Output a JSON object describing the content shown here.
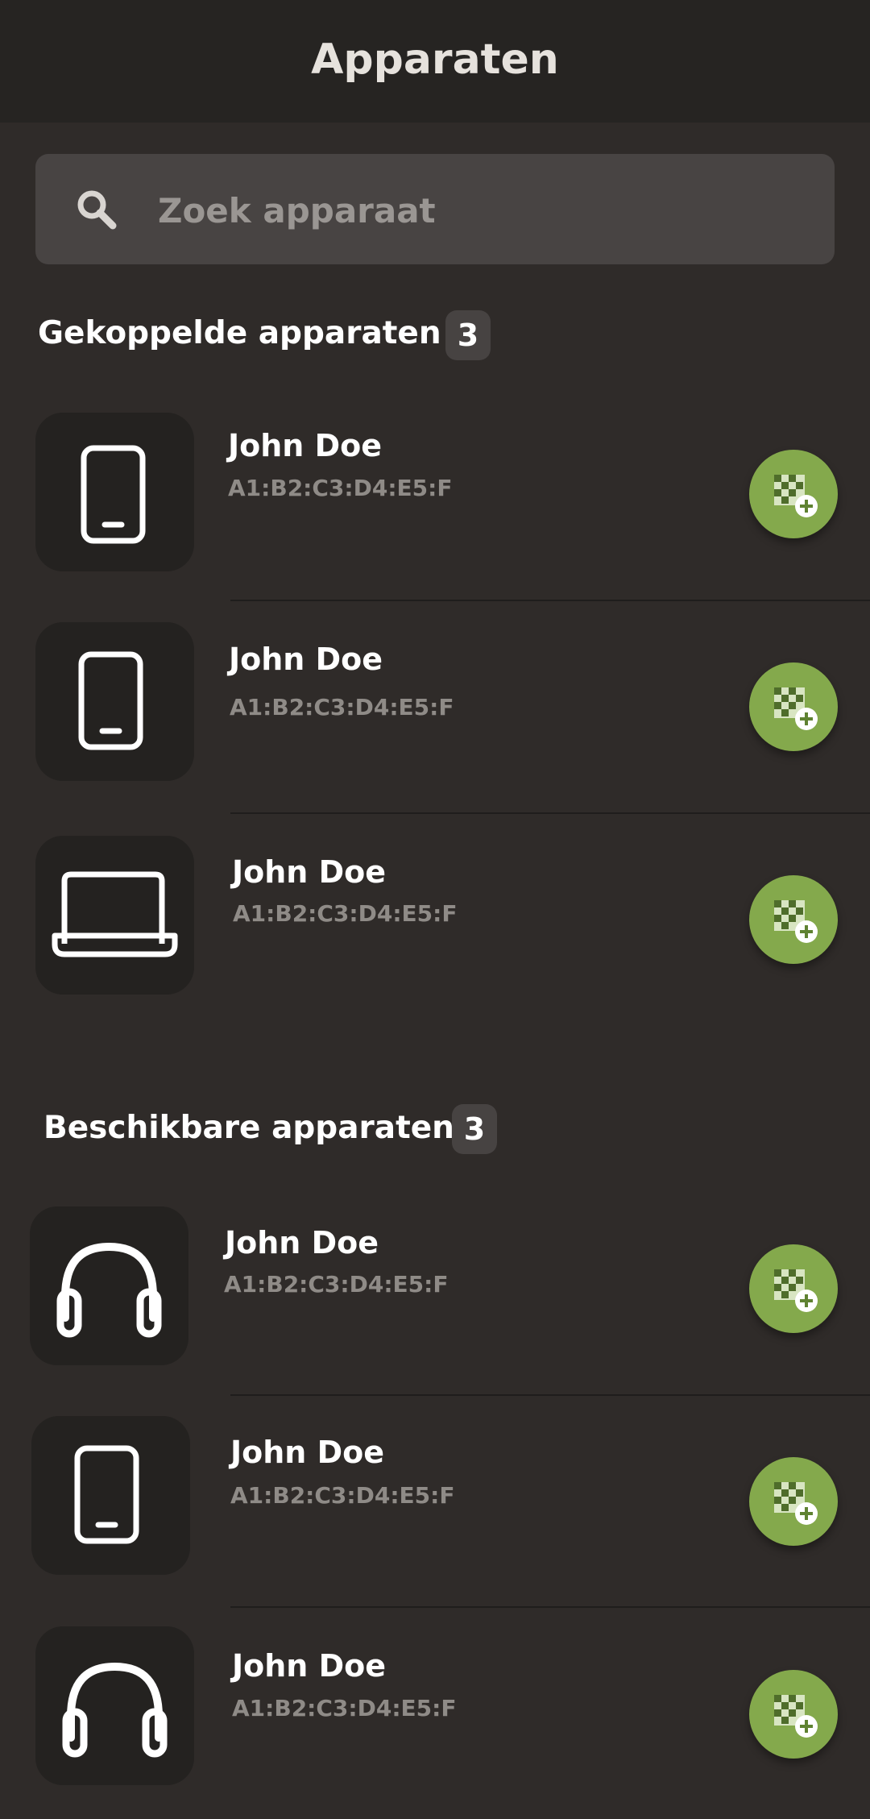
{
  "header": {
    "title": "Apparaten"
  },
  "search": {
    "placeholder": "Zoek apparaat",
    "value": ""
  },
  "sections": [
    {
      "title": "Gekoppelde apparaten",
      "count": "3",
      "devices": [
        {
          "name": "John Doe",
          "mac": "A1:B2:C3:D4:E5:F",
          "icon": "phone-icon"
        },
        {
          "name": "John Doe",
          "mac": "A1:B2:C3:D4:E5:F",
          "icon": "phone-icon"
        },
        {
          "name": "John Doe",
          "mac": "A1:B2:C3:D4:E5:F",
          "icon": "laptop-icon"
        }
      ]
    },
    {
      "title": "Beschikbare apparaten",
      "count": "3",
      "devices": [
        {
          "name": "John Doe",
          "mac": "A1:B2:C3:D4:E5:F",
          "icon": "headphones-icon"
        },
        {
          "name": "John Doe",
          "mac": "A1:B2:C3:D4:E5:F",
          "icon": "phone-icon"
        },
        {
          "name": "John Doe",
          "mac": "A1:B2:C3:D4:E5:F",
          "icon": "headphones-icon"
        }
      ]
    }
  ],
  "colors": {
    "background": "#2f2b29",
    "header": "#262422",
    "tile": "#242220",
    "accent_green": "#84a94c",
    "mac_text": "#8f8b87"
  },
  "action_icon": "qr-add-icon"
}
